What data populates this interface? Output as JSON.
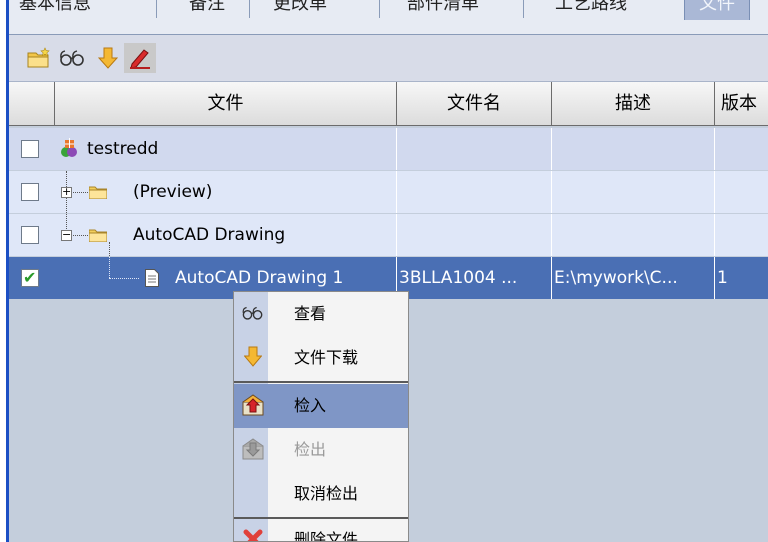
{
  "tabs": [
    {
      "label": "基本信息",
      "active": false
    },
    {
      "label": "备注",
      "active": false
    },
    {
      "label": "更改单",
      "active": false
    },
    {
      "label": "部件清单",
      "active": false
    },
    {
      "label": "工艺路线",
      "active": false
    },
    {
      "label": "文件",
      "active": true
    }
  ],
  "toolbar": {
    "buttons": [
      {
        "icon": "new-folder-icon"
      },
      {
        "icon": "view-glasses-icon"
      },
      {
        "icon": "download-arrow-icon"
      },
      {
        "icon": "edit-pen-icon"
      }
    ]
  },
  "grid": {
    "columns": [
      "文件",
      "文件名",
      "描述",
      "版本"
    ],
    "rows": [
      {
        "checked": false,
        "icon": "project-icon",
        "file": "testredd",
        "name": "",
        "desc": "",
        "version": ""
      },
      {
        "checked": false,
        "icon": "folder-icon",
        "file": "(Preview)",
        "name": "",
        "desc": "",
        "version": ""
      },
      {
        "checked": false,
        "icon": "folder-icon",
        "file": "AutoCAD Drawing",
        "name": "",
        "desc": "",
        "version": ""
      },
      {
        "checked": true,
        "icon": "document-icon",
        "file": "AutoCAD Drawing 1",
        "name": "3BLLA1004 ...",
        "desc": "E:\\mywork\\C...",
        "version": "1"
      }
    ]
  },
  "context_menu": {
    "items": [
      {
        "label": "查看",
        "icon": "view-glasses-icon",
        "disabled": false,
        "highlighted": false
      },
      {
        "label": "文件下载",
        "icon": "download-arrow-icon",
        "disabled": false,
        "highlighted": false
      },
      {
        "label": "检入",
        "icon": "checkin-icon",
        "disabled": false,
        "highlighted": true
      },
      {
        "label": "检出",
        "icon": "checkout-icon",
        "disabled": true,
        "highlighted": false
      },
      {
        "label": "取消检出",
        "icon": "",
        "disabled": false,
        "highlighted": false
      },
      {
        "label": "删除文件",
        "icon": "delete-x-icon",
        "disabled": false,
        "highlighted": false
      }
    ]
  },
  "colors": {
    "selected_row": "#4a6fb4",
    "row_blue": "#d8e2f6",
    "menu_highlight": "#7f96c6"
  }
}
